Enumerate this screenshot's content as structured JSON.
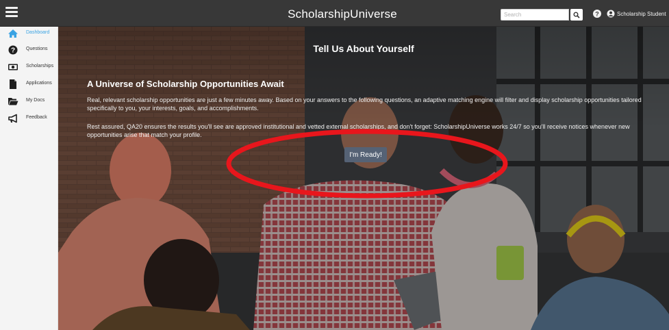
{
  "app": {
    "title": "ScholarshipUniverse"
  },
  "header": {
    "search_placeholder": "Search",
    "user_label": "Scholarship Student",
    "icons": [
      "menu-icon",
      "search-icon",
      "help-icon",
      "user-icon"
    ]
  },
  "sidebar": {
    "items": [
      {
        "label": "Dashboard",
        "icon": "home-icon",
        "active": true
      },
      {
        "label": "Questions",
        "icon": "question-icon",
        "active": false
      },
      {
        "label": "Scholarships",
        "icon": "money-icon",
        "active": false
      },
      {
        "label": "Applications",
        "icon": "file-icon",
        "active": false
      },
      {
        "label": "My Docs",
        "icon": "folder-icon",
        "active": false
      },
      {
        "label": "Feedback",
        "icon": "megaphone-icon",
        "active": false
      }
    ],
    "active_color": "#3aa3e3"
  },
  "hero": {
    "title": "Tell Us About Yourself",
    "subtitle": "A Universe of Scholarship Opportunities Await",
    "paragraph1": "Real, relevant scholarship opportunities are just a few minutes away. Based on your answers to the following questions, an adaptive matching engine will filter and display scholarship opportunities tailored specifically to you, your interests, goals, and accomplishments.",
    "paragraph2": "Rest assured, QA20 ensures the results you'll see are approved institutional and vetted external scholarships, and don't forget: ScholarshipUniverse works 24/7 so you'll receive notices whenever new opportunities arise that match your profile.",
    "cta_label": "I'm Ready!"
  },
  "annotation": {
    "shape": "ellipse",
    "color": "#e8161c",
    "target": "cta-button"
  }
}
